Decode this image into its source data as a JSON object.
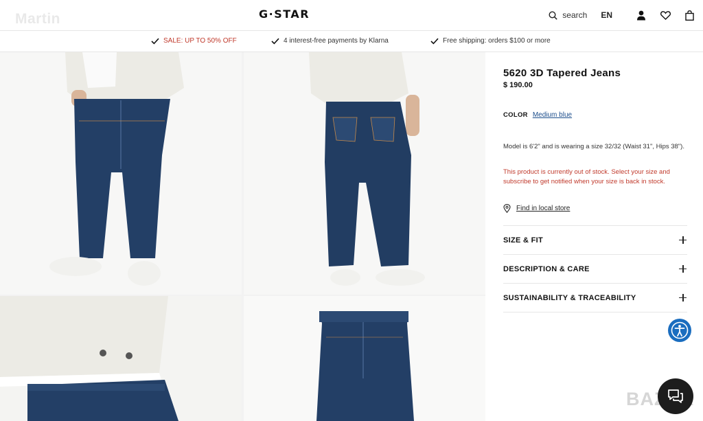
{
  "watermark_top": "Martin",
  "watermark_bottom": "BAZAR",
  "header": {
    "logo": "G·STAR",
    "search_label": "search",
    "language": "EN",
    "icons": [
      "search-icon",
      "account-icon",
      "wishlist-heart-icon",
      "shopping-bag-icon"
    ]
  },
  "usp_bar": {
    "items": [
      {
        "label": "SALE: UP TO 50% OFF",
        "color": "#c0392b"
      },
      {
        "label": "4 interest-free payments by Klarna"
      },
      {
        "label": "Free shipping: orders $100 or more"
      }
    ]
  },
  "gallery": {
    "images": [
      "jeans-front-view",
      "jeans-back-view",
      "jacket-and-waistband-detail",
      "flat-lay-jeans"
    ],
    "denim_color": "#1e3a5f",
    "jacket_color": "#ecebe5"
  },
  "product": {
    "title": "5620 3D Tapered Jeans",
    "price": "$ 190.00",
    "color_label": "COLOR",
    "color_value": "Medium blue",
    "model_info": "Model is 6'2\" and is wearing a size 32/32 (Waist 31\", Hips 38\").",
    "stock_message": "This product is currently out of stock. Select your size and subscribe to get notified when your size is back in stock.",
    "store_link": "Find in local store"
  },
  "accordion": [
    {
      "label": "SIZE & FIT"
    },
    {
      "label": "DESCRIPTION & CARE"
    },
    {
      "label": "SUSTAINABILITY & TRACEABILITY"
    }
  ],
  "colors": {
    "accent_link": "#1c4e8c",
    "sale_red": "#c0392b",
    "accessibility_blue": "#1a6dbf"
  }
}
